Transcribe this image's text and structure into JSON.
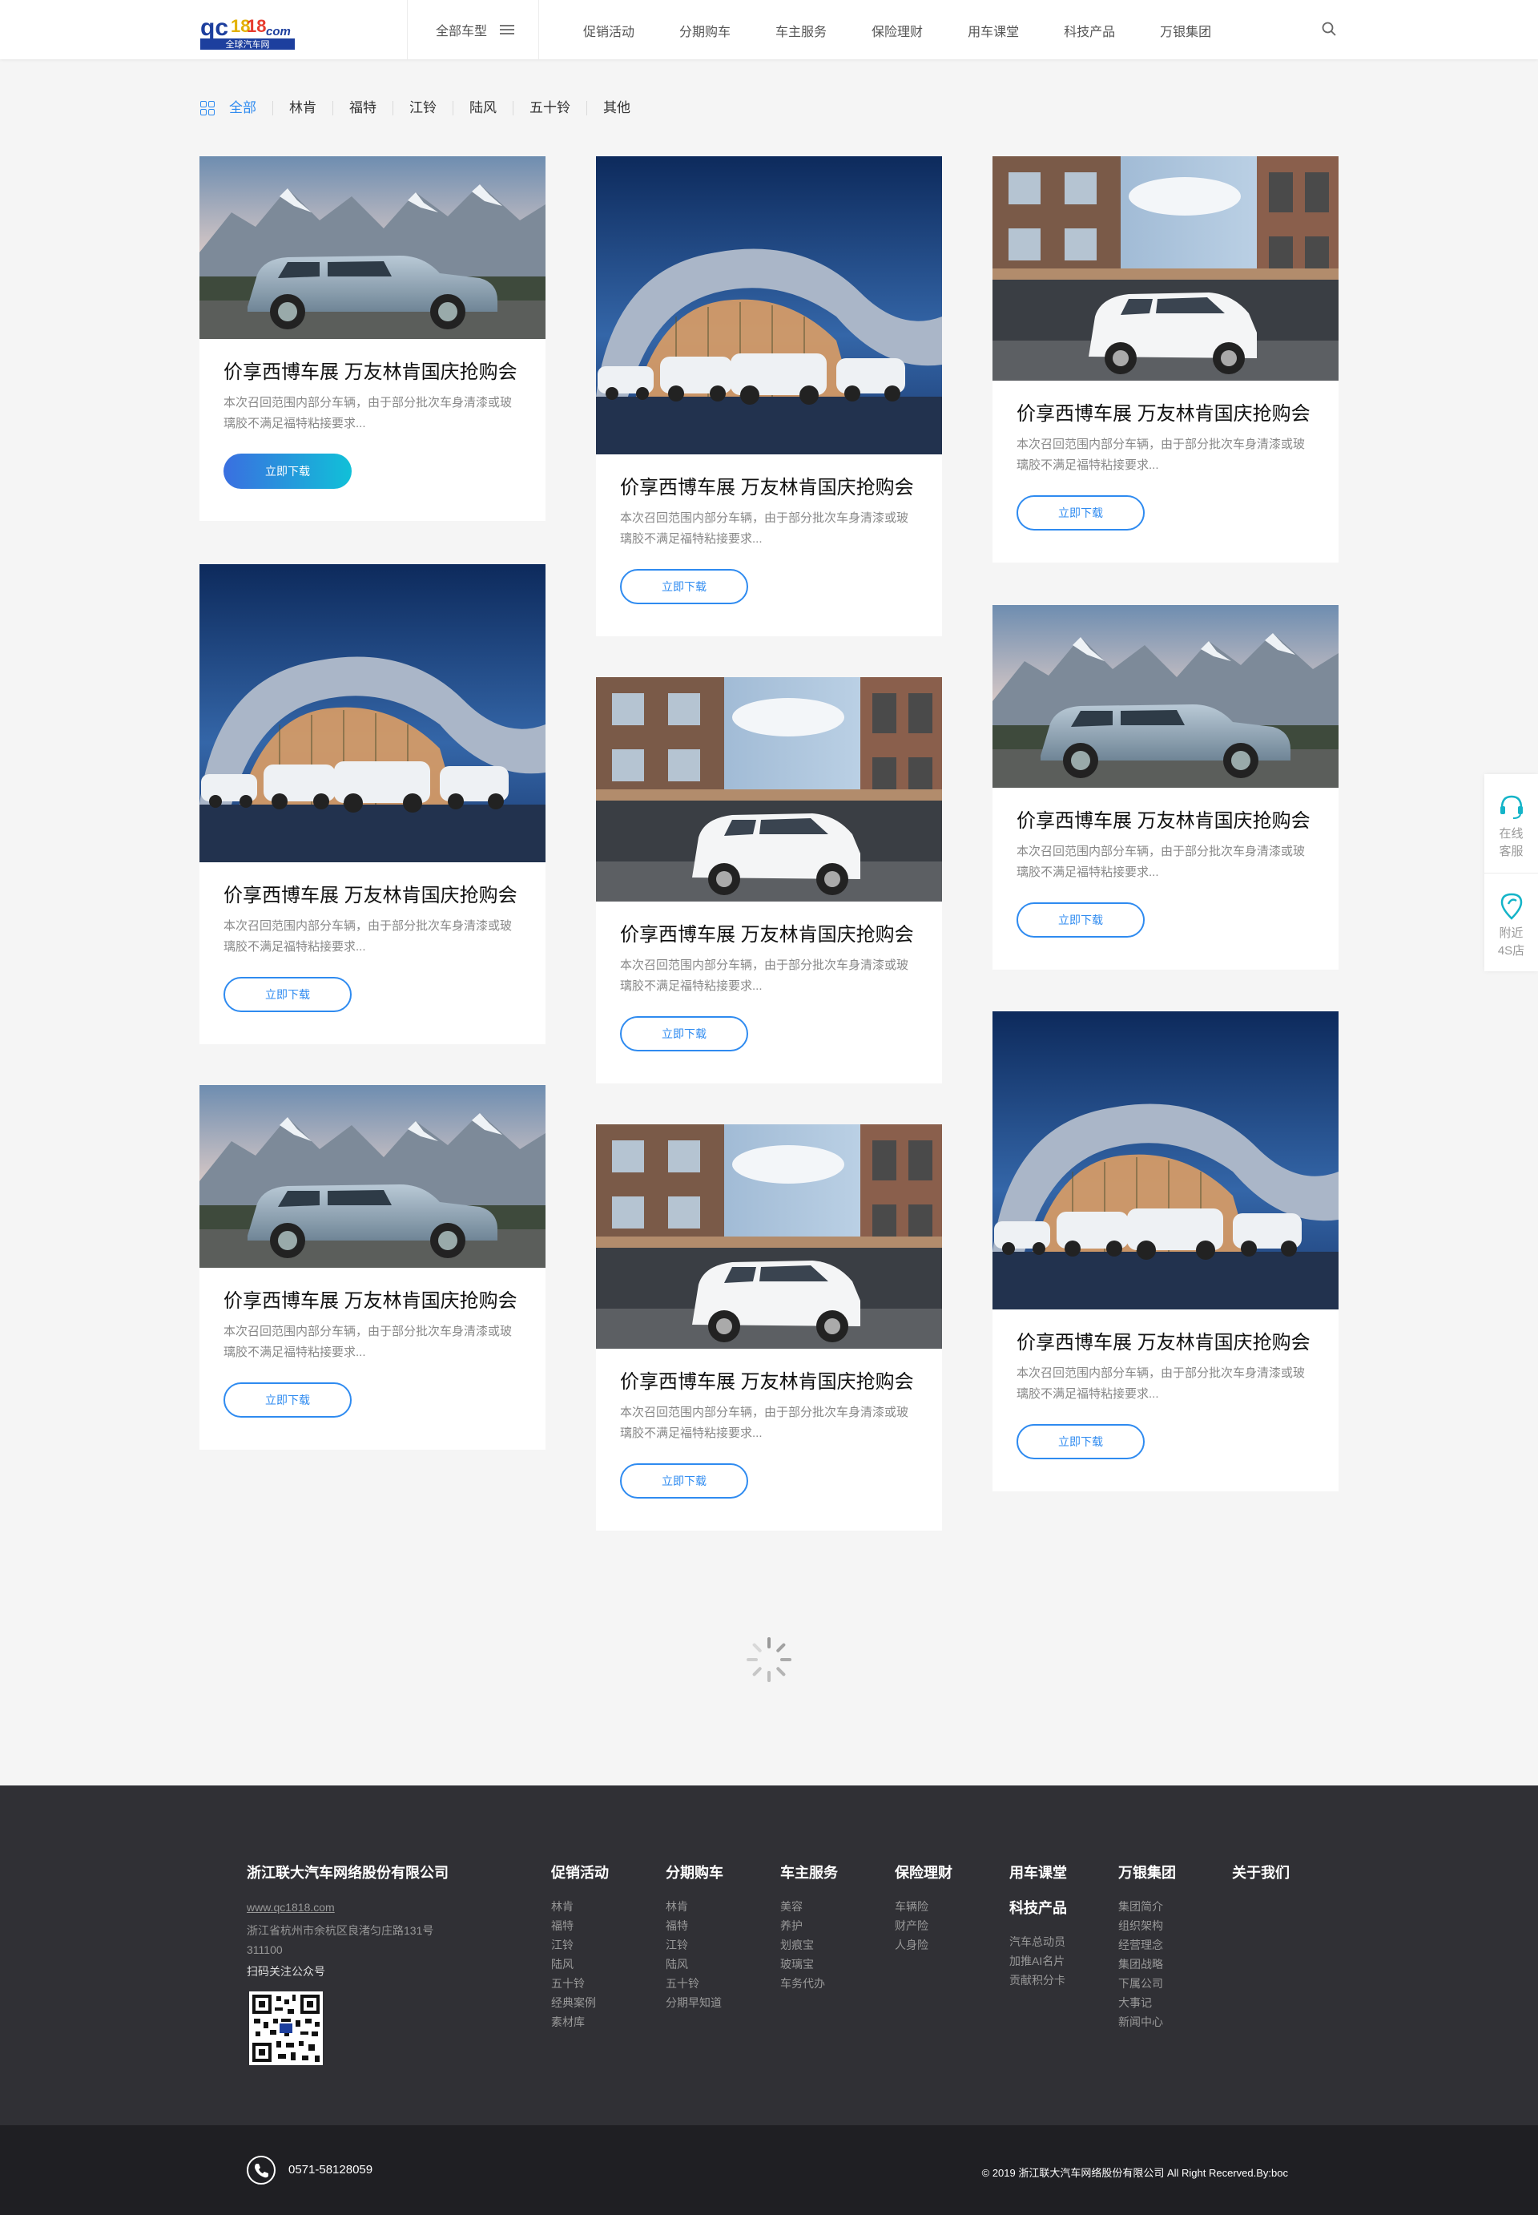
{
  "header": {
    "logo_text": "qc1818.com",
    "logo_subtext": "全球汽车网",
    "all_models": "全部车型",
    "nav": [
      "促销活动",
      "分期购车",
      "车主服务",
      "保险理财",
      "用车课堂",
      "科技产品",
      "万银集团"
    ]
  },
  "filter": [
    "全部",
    "林肯",
    "福特",
    "江铃",
    "陆风",
    "五十铃",
    "其他"
  ],
  "card_text": {
    "title": "价享西博车展 万友林肯国庆抢购会",
    "desc": "本次召回范围内部分车辆，由于部分批次车身清漆或玻璃胶不满足福特粘接要求...",
    "button": "立即下载"
  },
  "cards": [
    {
      "image": "suv-mountains",
      "active": true
    },
    {
      "image": "showroom-lineup",
      "active": false
    },
    {
      "image": "suv-mountains",
      "active": false
    },
    {
      "image": "showroom-lineup",
      "active": false
    },
    {
      "image": "white-suv-building",
      "active": false
    },
    {
      "image": "white-suv-building",
      "active": false
    },
    {
      "image": "white-suv-building",
      "active": false
    },
    {
      "image": "suv-mountains",
      "active": false
    },
    {
      "image": "showroom-lineup",
      "active": false
    }
  ],
  "sidebar": {
    "service": [
      "在线",
      "客服"
    ],
    "nearby": [
      "附近",
      "4S店"
    ]
  },
  "footer": {
    "company": "浙江联大汽车网络股份有限公司",
    "url": "www.qc1818.com",
    "address": "浙江省杭州市余杭区良渚匀庄路131号 311100",
    "scan": "扫码关注公众号",
    "columns": [
      {
        "title": "促销活动",
        "links": [
          "林肯",
          "福特",
          "江铃",
          "陆风",
          "五十铃",
          "经典案例",
          "素材库"
        ]
      },
      {
        "title": "分期购车",
        "links": [
          "林肯",
          "福特",
          "江铃",
          "陆风",
          "五十铃",
          "分期早知道"
        ]
      },
      {
        "title": "车主服务",
        "links": [
          "美容",
          "养护",
          "划痕宝",
          "玻璃宝",
          "车务代办"
        ]
      },
      {
        "title": "保险理财",
        "links": [
          "车辆险",
          "财产险",
          "人身险"
        ]
      },
      {
        "title": "用车课堂",
        "links": []
      },
      {
        "title": "万银集团",
        "links": [
          "集团简介",
          "组织架构",
          "经营理念",
          "集团战略",
          "下属公司",
          "大事记",
          "新闻中心"
        ]
      },
      {
        "title": "关于我们",
        "links": []
      }
    ],
    "tech": {
      "title": "科技产品",
      "links": [
        "汽车总动员",
        "加推AI名片",
        "贡献积分卡"
      ]
    },
    "phone": "0571-58128059",
    "copyright": "© 2019 浙江联大汽车网络股份有限公司 All Right Recerved.By:boc"
  }
}
